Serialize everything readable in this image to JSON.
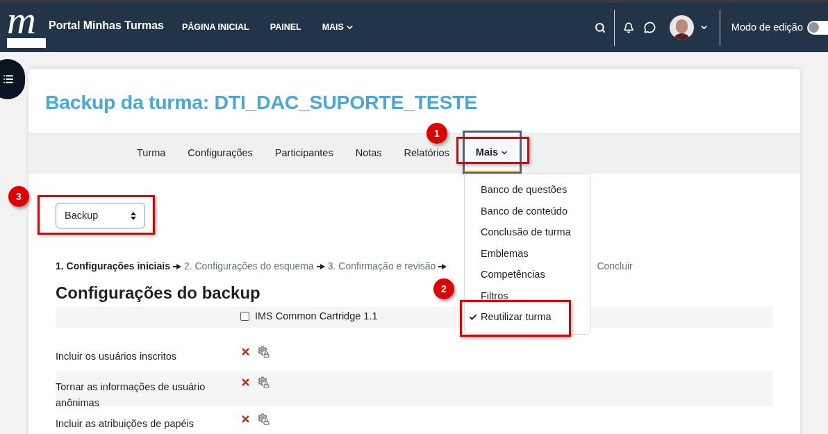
{
  "navbar": {
    "logo_letter": "m",
    "site_name": "Portal Minhas Turmas",
    "links": [
      {
        "label": "PÁGINA INICIAL",
        "dropdown": false
      },
      {
        "label": "PAINEL",
        "dropdown": false
      },
      {
        "label": "MAIS",
        "dropdown": true
      }
    ],
    "edit_mode": {
      "label": "Modo de edição",
      "on": false
    }
  },
  "page": {
    "title": "Backup da turma: DTI_DAC_SUPORTE_TESTE",
    "tabs": [
      {
        "label": "Turma",
        "selected": false,
        "dropdown": false
      },
      {
        "label": "Configurações",
        "selected": false,
        "dropdown": false
      },
      {
        "label": "Participantes",
        "selected": false,
        "dropdown": false
      },
      {
        "label": "Notas",
        "selected": false,
        "dropdown": false
      },
      {
        "label": "Relatórios",
        "selected": false,
        "dropdown": false
      },
      {
        "label": "Mais",
        "selected": true,
        "dropdown": true
      }
    ],
    "more_menu": [
      {
        "label": "Banco de questões",
        "checked": false
      },
      {
        "label": "Banco de conteúdo",
        "checked": false
      },
      {
        "label": "Conclusão de turma",
        "checked": false
      },
      {
        "label": "Emblemas",
        "checked": false
      },
      {
        "label": "Competências",
        "checked": false
      },
      {
        "label": "Filtros",
        "checked": false
      },
      {
        "label": "Reutilizar turma",
        "checked": true
      }
    ],
    "action_select": {
      "value": "Backup"
    },
    "steps": [
      {
        "label": "1. Configurações iniciais",
        "selected": true
      },
      {
        "label": "2. Configurações do esquema",
        "selected": false
      },
      {
        "label": "3. Confirmação e revisão",
        "selected": false
      },
      {
        "label": "Concluir",
        "selected": false
      }
    ],
    "section_title": "Configurações do backup",
    "settings": [
      {
        "kind": "checkbox",
        "label": "IMS Common Cartridge 1.1",
        "checked": false
      },
      {
        "kind": "locked",
        "label": "Incluir os usuários inscritos",
        "checked": false
      },
      {
        "kind": "locked",
        "label": "Tornar as informações de usuário anônimas",
        "checked": false
      },
      {
        "kind": "locked",
        "label": "Incluir as atribuições de papéis",
        "checked": false
      }
    ]
  },
  "annotations": [
    {
      "label": "1"
    },
    {
      "label": "2"
    },
    {
      "label": "3"
    }
  ]
}
